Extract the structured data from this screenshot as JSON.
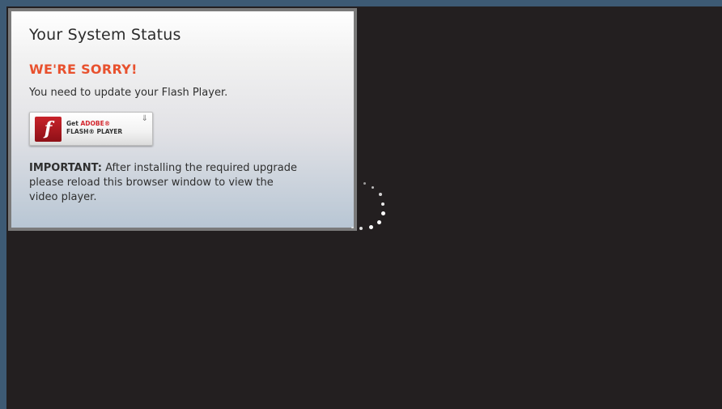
{
  "status_box": {
    "title": "Your System Status",
    "heading": "WE'RE SORRY!",
    "message": "You need to update your Flash Player.",
    "important_label": "IMPORTANT:",
    "important_text": "After installing the required upgrade please reload this browser window to view the video player."
  },
  "flash_button": {
    "logo_glyph": "f",
    "get_label": "Get",
    "adobe_label": "ADOBE®",
    "product_label": "FLASH® PLAYER",
    "download_glyph": "⇓"
  },
  "colors": {
    "page_frame": "#3d5a74",
    "player_background": "#231f20",
    "heading_accent": "#e8512e",
    "flash_red": "#c8232a",
    "box_border": "#7a7a7a"
  },
  "icons": {
    "flash_logo": "flash-logo-icon",
    "download": "download-arrow-icon",
    "spinner": "loading-spinner-icon"
  }
}
